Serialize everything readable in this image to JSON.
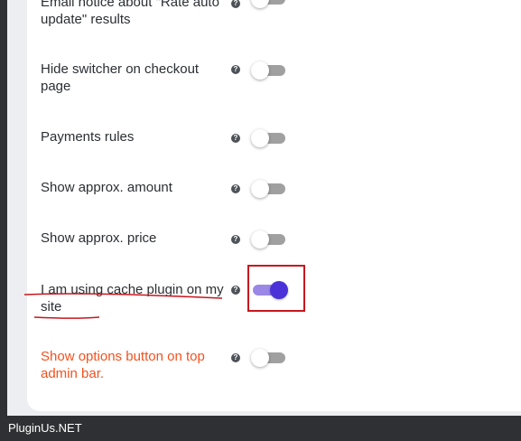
{
  "settings": {
    "rows": [
      {
        "label": "Email notice about \"Rate auto update\" results",
        "state": "off"
      },
      {
        "label": "Hide switcher on checkout page",
        "state": "off"
      },
      {
        "label": "Payments rules",
        "state": "off"
      },
      {
        "label": "Show approx. amount",
        "state": "off"
      },
      {
        "label": "Show approx. price",
        "state": "off"
      },
      {
        "label": "I am using cache plugin on my site",
        "state": "on"
      },
      {
        "label": "Show options button on top admin bar.",
        "state": "off"
      }
    ],
    "help_glyph": "?"
  },
  "colors": {
    "toggle_on_track": "#9b87e6",
    "toggle_on_knob": "#4a32d8",
    "toggle_off_track": "#a0a0a0",
    "label_accent": "#f4511e",
    "annotation_red": "#c8161d"
  },
  "footer": {
    "text": "PluginUs.NET"
  }
}
